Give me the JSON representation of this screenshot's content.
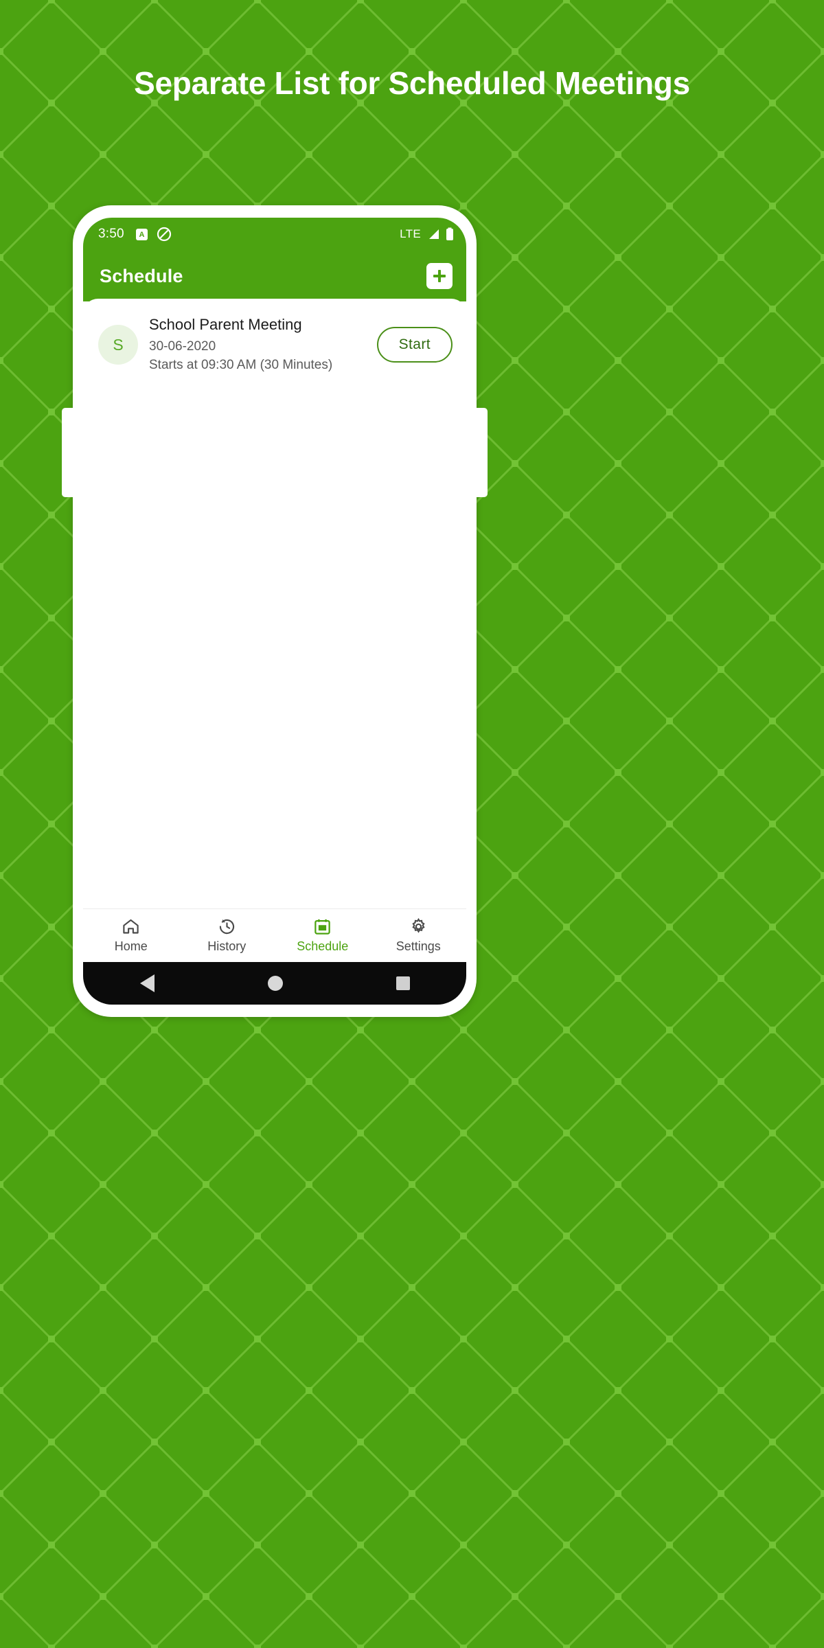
{
  "theme": {
    "brand_green": "#4ca311",
    "accent_green": "#57a926",
    "card_white": "#ffffff",
    "pattern_green": "#68b72c"
  },
  "hero": {
    "title": "Separate List for Scheduled Meetings"
  },
  "phone": {
    "statusbar": {
      "time": "3:50",
      "icons": [
        "a-badge-icon",
        "do-not-disturb-icon"
      ],
      "network_label": "LTE",
      "signal_icon": "signal-bars-icon",
      "battery_icon": "battery-icon"
    },
    "appbar": {
      "title": "Schedule",
      "add_button_label": "+",
      "add_button_icon": "plus-icon"
    },
    "meetings": [
      {
        "avatar_initial": "S",
        "title": "School Parent Meeting",
        "date": "30-06-2020",
        "time": "Starts at 09:30 AM (30 Minutes)",
        "action_label": "Start"
      }
    ],
    "bottom_nav": {
      "items": [
        {
          "label": "Home",
          "icon": "home-icon",
          "active": false
        },
        {
          "label": "History",
          "icon": "history-clock-icon",
          "active": false
        },
        {
          "label": "Schedule",
          "icon": "calendar-icon",
          "active": true
        },
        {
          "label": "Settings",
          "icon": "gear-icon",
          "active": false
        }
      ]
    },
    "system_nav": {
      "back": "back-triangle-icon",
      "home": "home-circle-icon",
      "recents": "recents-square-icon"
    }
  }
}
